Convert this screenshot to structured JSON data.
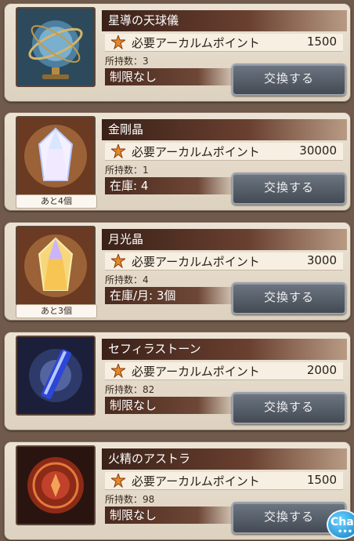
{
  "colors": {
    "accent_title": "#4a2a1e",
    "button": "#4f5761"
  },
  "items": [
    {
      "name": "星導の天球儀",
      "cost_label": "必要アーカルムポイント",
      "cost": "1500",
      "owned": "所持数：3",
      "limit": "制限なし",
      "stock_tag": "",
      "button": "交換する",
      "icon": "celestial-globe-icon"
    },
    {
      "name": "金剛晶",
      "cost_label": "必要アーカルムポイント",
      "cost": "30000",
      "owned": "所持数：1",
      "limit": "在庫: 4",
      "stock_tag": "あと4個",
      "button": "交換する",
      "icon": "diamond-crystal-icon"
    },
    {
      "name": "月光晶",
      "cost_label": "必要アーカルムポイント",
      "cost": "3000",
      "owned": "所持数：4",
      "limit": "在庫/月: 3個",
      "stock_tag": "あと3個",
      "button": "交換する",
      "icon": "moonlight-crystal-icon"
    },
    {
      "name": "セフィラストーン",
      "cost_label": "必要アーカルムポイント",
      "cost": "2000",
      "owned": "所持数：82",
      "limit": "制限なし",
      "stock_tag": "",
      "button": "交換する",
      "icon": "sephira-stone-icon"
    },
    {
      "name": "火精のアストラ",
      "cost_label": "必要アーカルムポイント",
      "cost": "1500",
      "owned": "所持数：98",
      "limit": "制限なし",
      "stock_tag": "",
      "button": "交換する",
      "icon": "fire-astra-icon"
    }
  ],
  "chat": {
    "label": "Chat",
    "dots": "•••"
  }
}
